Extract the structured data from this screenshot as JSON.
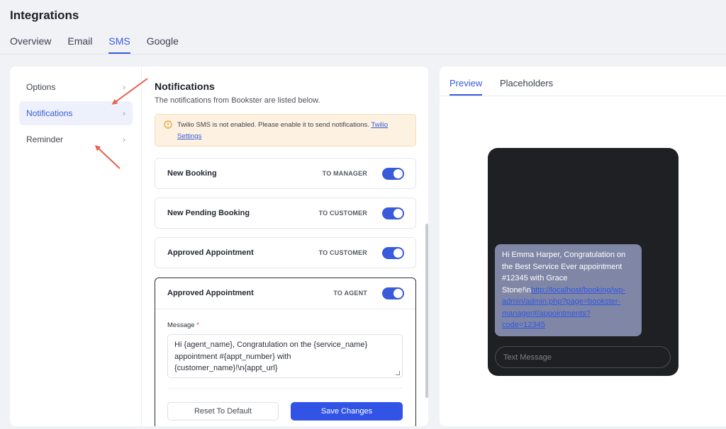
{
  "page": {
    "title": "Integrations"
  },
  "tabs": [
    {
      "label": "Overview",
      "active": false
    },
    {
      "label": "Email",
      "active": false
    },
    {
      "label": "SMS",
      "active": true
    },
    {
      "label": "Google",
      "active": false
    }
  ],
  "sidebar": {
    "items": [
      {
        "label": "Options",
        "active": false
      },
      {
        "label": "Notifications",
        "active": true
      },
      {
        "label": "Reminder",
        "active": false
      }
    ],
    "chevron": "›"
  },
  "content": {
    "title": "Notifications",
    "subtitle": "The notifications from Bookster are listed below.",
    "warning": {
      "icon": "warning-circle-icon",
      "text": "Twilio SMS is not enabled. Please enable it to send notifications.",
      "link_line1": "Twilio",
      "link_line2": "Settings"
    },
    "rows": [
      {
        "name": "New Booking",
        "target": "TO MANAGER",
        "enabled": true
      },
      {
        "name": "New Pending Booking",
        "target": "TO CUSTOMER",
        "enabled": true
      },
      {
        "name": "Approved Appointment",
        "target": "TO CUSTOMER",
        "enabled": true
      }
    ],
    "expanded": {
      "name": "Approved Appointment",
      "target": "TO AGENT",
      "enabled": true,
      "message_label": "Message",
      "required_mark": "*",
      "message_lines": [
        "Hi {agent_name}, Congratulation on the {service_name}",
        "appointment #{appt_number} with",
        "{customer_name}!\\n{appt_url}"
      ],
      "reset_label": "Reset To Default",
      "save_label": "Save Changes"
    }
  },
  "preview": {
    "tabs": [
      {
        "label": "Preview",
        "active": true
      },
      {
        "label": "Placeholders",
        "active": false
      }
    ],
    "bubble_lines": [
      "Hi Emma Harper, Congratulation on",
      "the Best Service Ever appointment",
      "#12345 with Grace"
    ],
    "bubble_tail": "Stone!\\n",
    "bubble_link_lines": [
      "http://localhost/booking/wp-",
      "admin/admin.php?page=bookster-",
      "manager#/appointments?",
      "code=12345"
    ],
    "input_placeholder": "Text Message"
  },
  "colors": {
    "accent": "#3a5bd9",
    "save_button": "#3254e6",
    "warning_bg": "#fdf1e1",
    "bubble_bg": "#8087a6",
    "phone_bg": "#1f2023",
    "annotation_arrow": "#e8604c"
  }
}
